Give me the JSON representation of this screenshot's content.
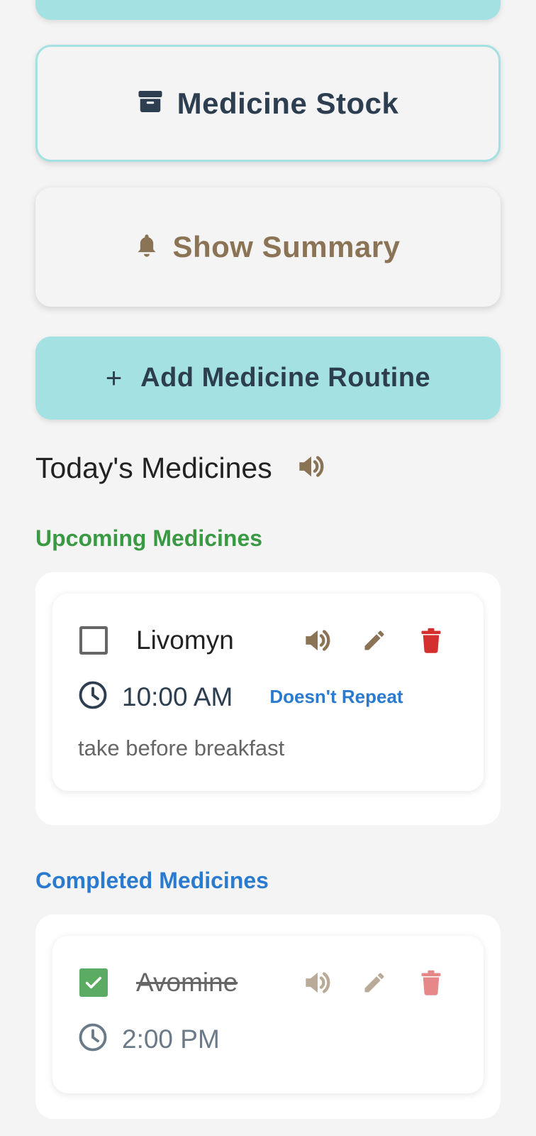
{
  "buttons": {
    "medicine_stock": "Medicine Stock",
    "show_summary": "Show Summary",
    "add_routine": "Add Medicine Routine",
    "add_routine_icon": "+"
  },
  "today": {
    "title": "Today's Medicines"
  },
  "upcoming": {
    "heading": "Upcoming Medicines",
    "items": [
      {
        "name": "Livomyn",
        "time": "10:00 AM",
        "repeat": "Doesn't Repeat",
        "note": "take before breakfast",
        "checked": false
      }
    ]
  },
  "completed": {
    "heading": "Completed Medicines",
    "items": [
      {
        "name": "Avomine",
        "time": "2:00 PM",
        "checked": true
      }
    ]
  },
  "colors": {
    "accent": "#a3e1e3",
    "brown": "#8b7356",
    "delete_red": "#d32f2f",
    "upcoming_green": "#3a9a44",
    "completed_blue": "#2a7bd0"
  }
}
